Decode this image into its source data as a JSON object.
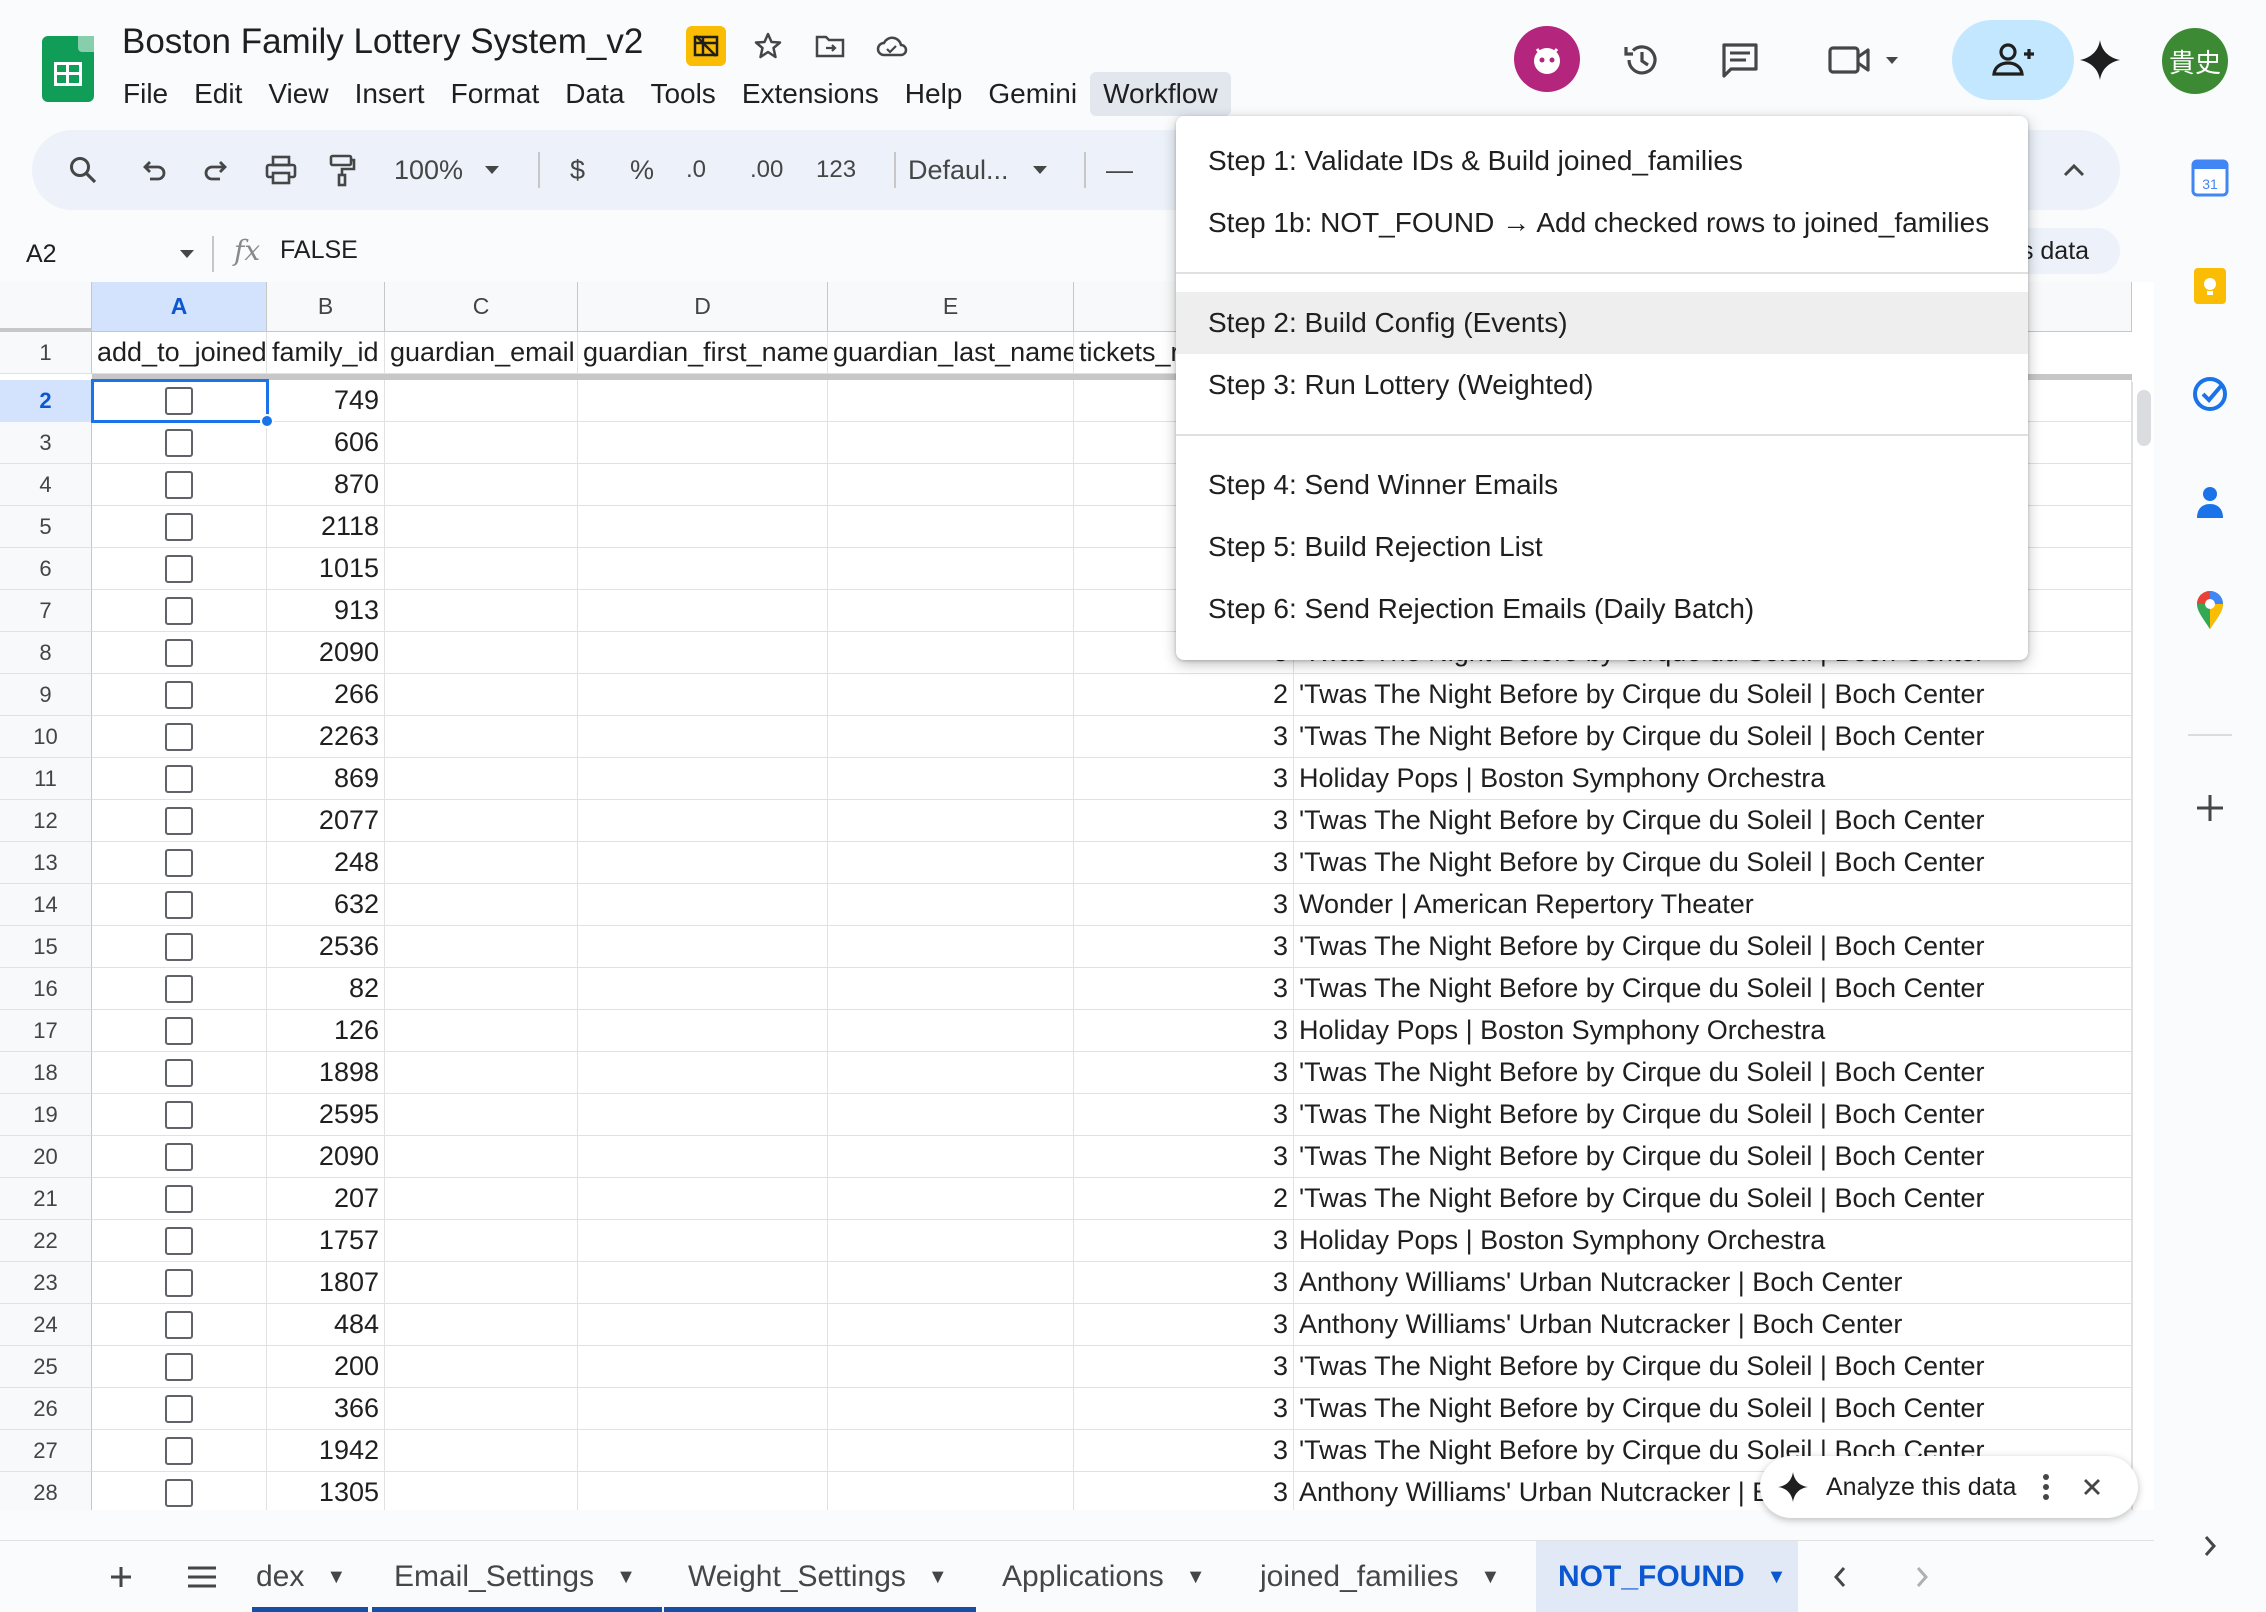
{
  "doc": {
    "title": "Boston Family Lottery System_v2"
  },
  "menubar": [
    "File",
    "Edit",
    "View",
    "Insert",
    "Format",
    "Data",
    "Tools",
    "Extensions",
    "Help",
    "Gemini",
    "Workflow"
  ],
  "header": {
    "user_initials": "貴史"
  },
  "toolbar": {
    "zoom": "100%",
    "currency": "$",
    "percent": "%",
    "dec_decrease": ".0",
    "dec_increase": ".00",
    "number_format": "123",
    "font": "Defaul...",
    "minus": "—"
  },
  "formula_bar": {
    "cell_ref": "A2",
    "fx": "fx",
    "value": "FALSE",
    "right_chip": "s data"
  },
  "columns": [
    "A",
    "B",
    "C",
    "D",
    "E"
  ],
  "header_row": {
    "row_number": "1",
    "cells": [
      "add_to_joined",
      "family_id",
      "guardian_email",
      "guardian_first_name",
      "guardian_last_name",
      "tickets_r"
    ]
  },
  "rows": [
    {
      "n": "2",
      "family_id": "749",
      "tickets": "",
      "event": ""
    },
    {
      "n": "3",
      "family_id": "606",
      "tickets": "",
      "event": ""
    },
    {
      "n": "4",
      "family_id": "870",
      "tickets": "",
      "event": ""
    },
    {
      "n": "5",
      "family_id": "2118",
      "tickets": "",
      "event": ""
    },
    {
      "n": "6",
      "family_id": "1015",
      "tickets": "",
      "event": ""
    },
    {
      "n": "7",
      "family_id": "913",
      "tickets": "",
      "event": ""
    },
    {
      "n": "8",
      "family_id": "2090",
      "tickets": "3",
      "event": "'Twas The Night Before by Cirque du Soleil | Boch Center"
    },
    {
      "n": "9",
      "family_id": "266",
      "tickets": "2",
      "event": "'Twas The Night Before by Cirque du Soleil | Boch Center"
    },
    {
      "n": "10",
      "family_id": "2263",
      "tickets": "3",
      "event": "'Twas The Night Before by Cirque du Soleil | Boch Center"
    },
    {
      "n": "11",
      "family_id": "869",
      "tickets": "3",
      "event": "Holiday Pops | Boston Symphony Orchestra"
    },
    {
      "n": "12",
      "family_id": "2077",
      "tickets": "3",
      "event": "'Twas The Night Before by Cirque du Soleil | Boch Center"
    },
    {
      "n": "13",
      "family_id": "248",
      "tickets": "3",
      "event": "'Twas The Night Before by Cirque du Soleil | Boch Center"
    },
    {
      "n": "14",
      "family_id": "632",
      "tickets": "3",
      "event": "Wonder | American Repertory Theater"
    },
    {
      "n": "15",
      "family_id": "2536",
      "tickets": "3",
      "event": "'Twas The Night Before by Cirque du Soleil | Boch Center"
    },
    {
      "n": "16",
      "family_id": "82",
      "tickets": "3",
      "event": "'Twas The Night Before by Cirque du Soleil | Boch Center"
    },
    {
      "n": "17",
      "family_id": "126",
      "tickets": "3",
      "event": "Holiday Pops | Boston Symphony Orchestra"
    },
    {
      "n": "18",
      "family_id": "1898",
      "tickets": "3",
      "event": "'Twas The Night Before by Cirque du Soleil | Boch Center"
    },
    {
      "n": "19",
      "family_id": "2595",
      "tickets": "3",
      "event": "'Twas The Night Before by Cirque du Soleil | Boch Center"
    },
    {
      "n": "20",
      "family_id": "2090",
      "tickets": "3",
      "event": "'Twas The Night Before by Cirque du Soleil | Boch Center"
    },
    {
      "n": "21",
      "family_id": "207",
      "tickets": "2",
      "event": "'Twas The Night Before by Cirque du Soleil | Boch Center"
    },
    {
      "n": "22",
      "family_id": "1757",
      "tickets": "3",
      "event": "Holiday Pops | Boston Symphony Orchestra"
    },
    {
      "n": "23",
      "family_id": "1807",
      "tickets": "3",
      "event": "Anthony Williams' Urban Nutcracker | Boch Center"
    },
    {
      "n": "24",
      "family_id": "484",
      "tickets": "3",
      "event": "Anthony Williams' Urban Nutcracker | Boch Center"
    },
    {
      "n": "25",
      "family_id": "200",
      "tickets": "3",
      "event": "'Twas The Night Before by Cirque du Soleil | Boch Center"
    },
    {
      "n": "26",
      "family_id": "366",
      "tickets": "3",
      "event": "'Twas The Night Before by Cirque du Soleil | Boch Center"
    },
    {
      "n": "27",
      "family_id": "1942",
      "tickets": "3",
      "event": "'Twas The Night Before by Cirque du Soleil | Boch Center"
    },
    {
      "n": "28",
      "family_id": "1305",
      "tickets": "3",
      "event": "Anthony Williams' Urban Nutcracker | E"
    }
  ],
  "workflow_menu": {
    "group1": [
      "Step 1: Validate IDs & Build joined_families",
      "Step 1b: NOT_FOUND → Add checked rows to joined_families"
    ],
    "group2": [
      "Step 2: Build Config (Events)",
      "Step 3: Run Lottery (Weighted)"
    ],
    "group3": [
      "Step 4: Send Winner Emails",
      "Step 5: Build Rejection List",
      "Step 6: Send Rejection Emails (Daily Batch)"
    ]
  },
  "analyze_popup": {
    "label": "Analyze this data"
  },
  "sheet_tabs": [
    "dex",
    "Email_Settings",
    "Weight_Settings",
    "Applications",
    "joined_families",
    "NOT_FOUND"
  ],
  "active_tab": "NOT_FOUND",
  "colors": {
    "accent": "#1a73e8",
    "sheets_green": "#0f9d58",
    "share_bg": "#c2e7ff",
    "active_tab_bg": "#e1e9f7"
  }
}
